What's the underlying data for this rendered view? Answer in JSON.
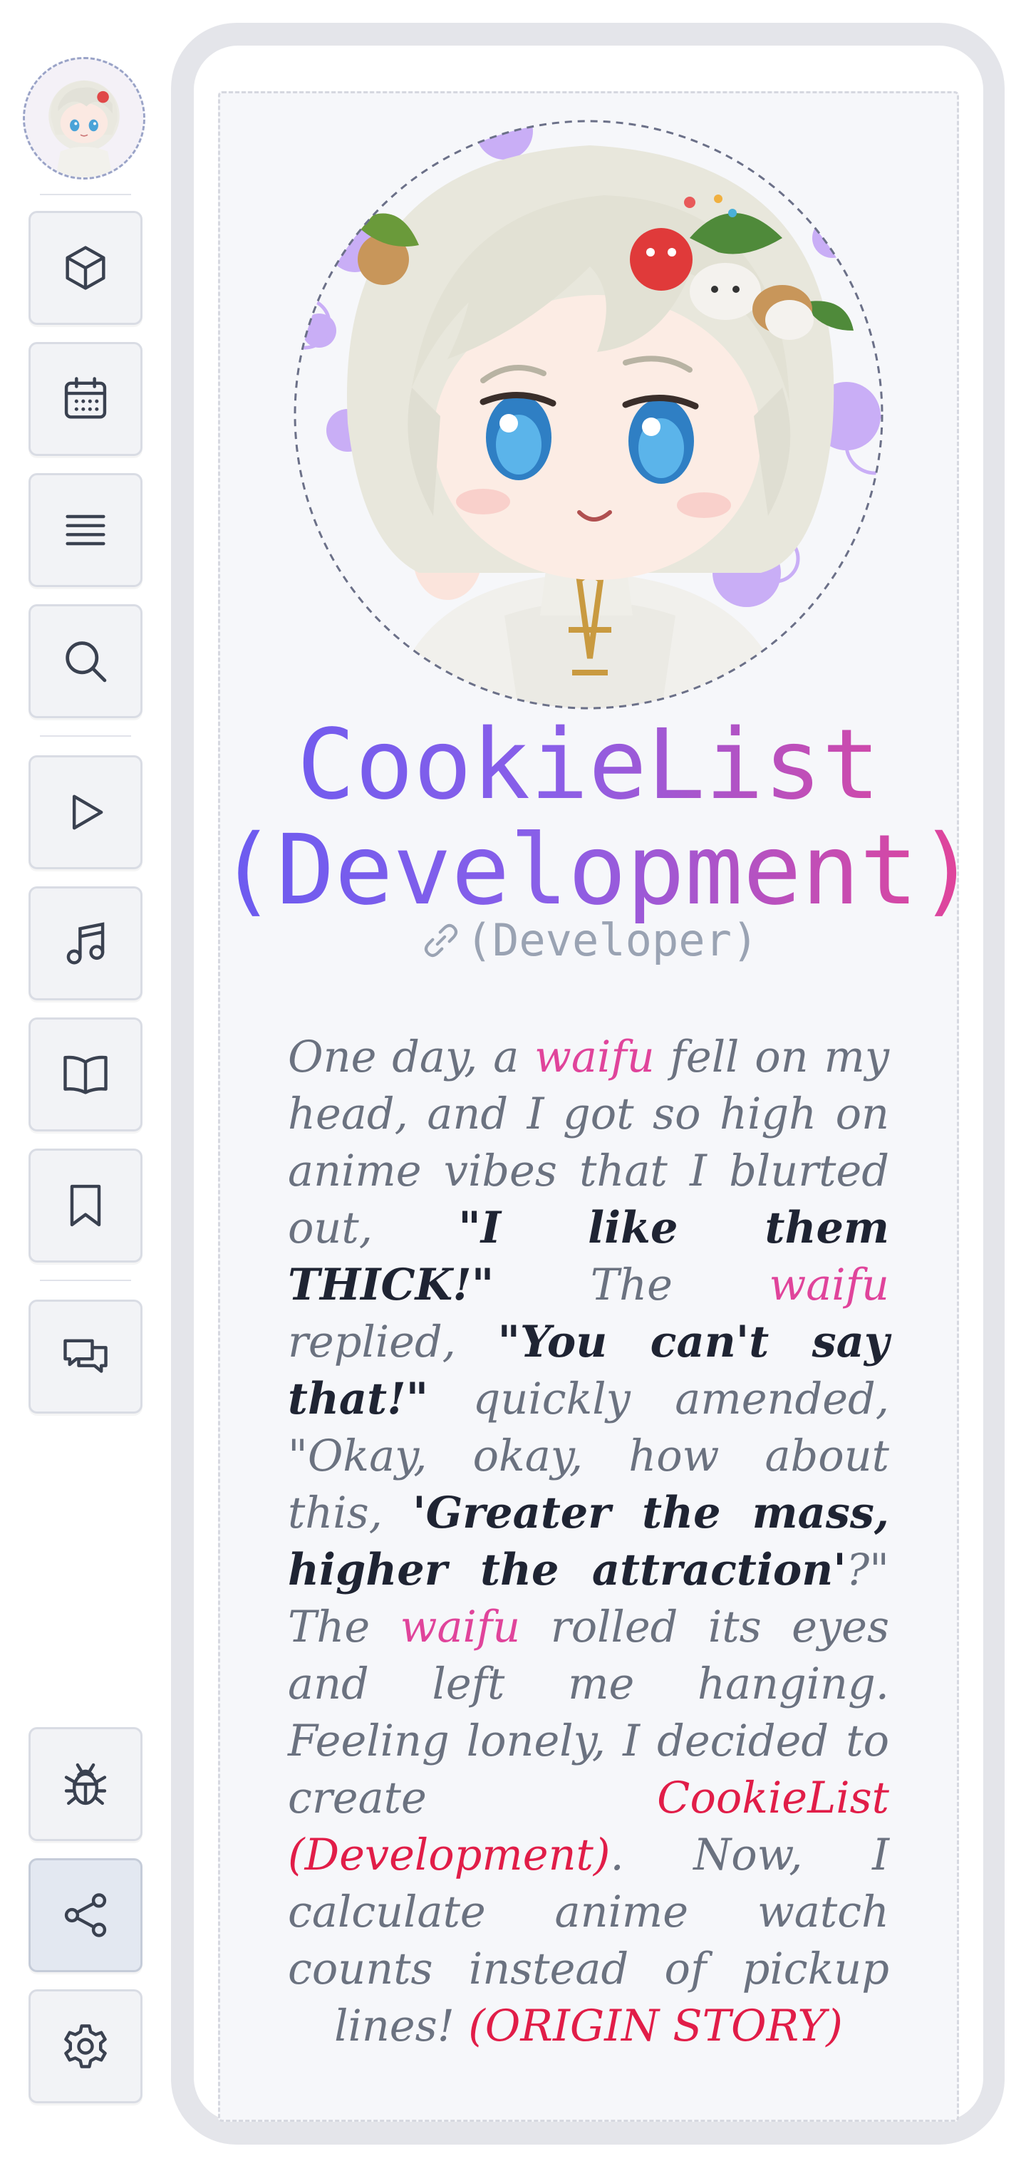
{
  "sidebar": {
    "avatar_alt": "CookieList avatar",
    "top_items": [
      {
        "name": "cube-icon"
      },
      {
        "name": "calendar-icon"
      },
      {
        "name": "list-icon"
      },
      {
        "name": "search-icon"
      }
    ],
    "media_items": [
      {
        "name": "play-icon"
      },
      {
        "name": "music-icon"
      },
      {
        "name": "book-icon"
      },
      {
        "name": "bookmark-icon"
      }
    ],
    "chat_item": {
      "name": "chat-icon"
    },
    "bottom_items": [
      {
        "name": "bug-icon"
      },
      {
        "name": "share-icon",
        "active": true
      },
      {
        "name": "gear-icon"
      }
    ]
  },
  "profile": {
    "title_line1": "CookieList",
    "title_line2": "(Development)",
    "role": "(Developer)",
    "link_icon": "link-icon"
  },
  "story": {
    "p1": "One day, a ",
    "waifu1": "waifu",
    "p2": " fell on my head, and I got so high on anime vibes that I blurted out, ",
    "quote1": "\"I like them THICK!\"",
    "p3": " The ",
    "waifu2": "waifu",
    "p4": " replied, ",
    "quote2": "\"You can't say that!\"",
    "p5": " quickly amended, \"Okay, okay, how about this, ",
    "quote3": "'Greater the mass, higher the attraction'",
    "p6": "?\" The ",
    "waifu3": "waifu",
    "p7": " rolled its eyes and left me hanging. Feeling lonely, I decided to create ",
    "app_name": "CookieList (Development)",
    "p8": ". Now, I calculate anime watch counts instead of pickup lines! ",
    "origin": "(ORIGIN STORY)"
  },
  "colors": {
    "gradient_start": "#6b5bf0",
    "gradient_end": "#e0449b",
    "highlight_pink": "#e0449b",
    "highlight_red": "#e11d48",
    "text_muted": "#6b7280",
    "text_dark": "#1f2433",
    "accent_purple": "#c4a5f5"
  }
}
